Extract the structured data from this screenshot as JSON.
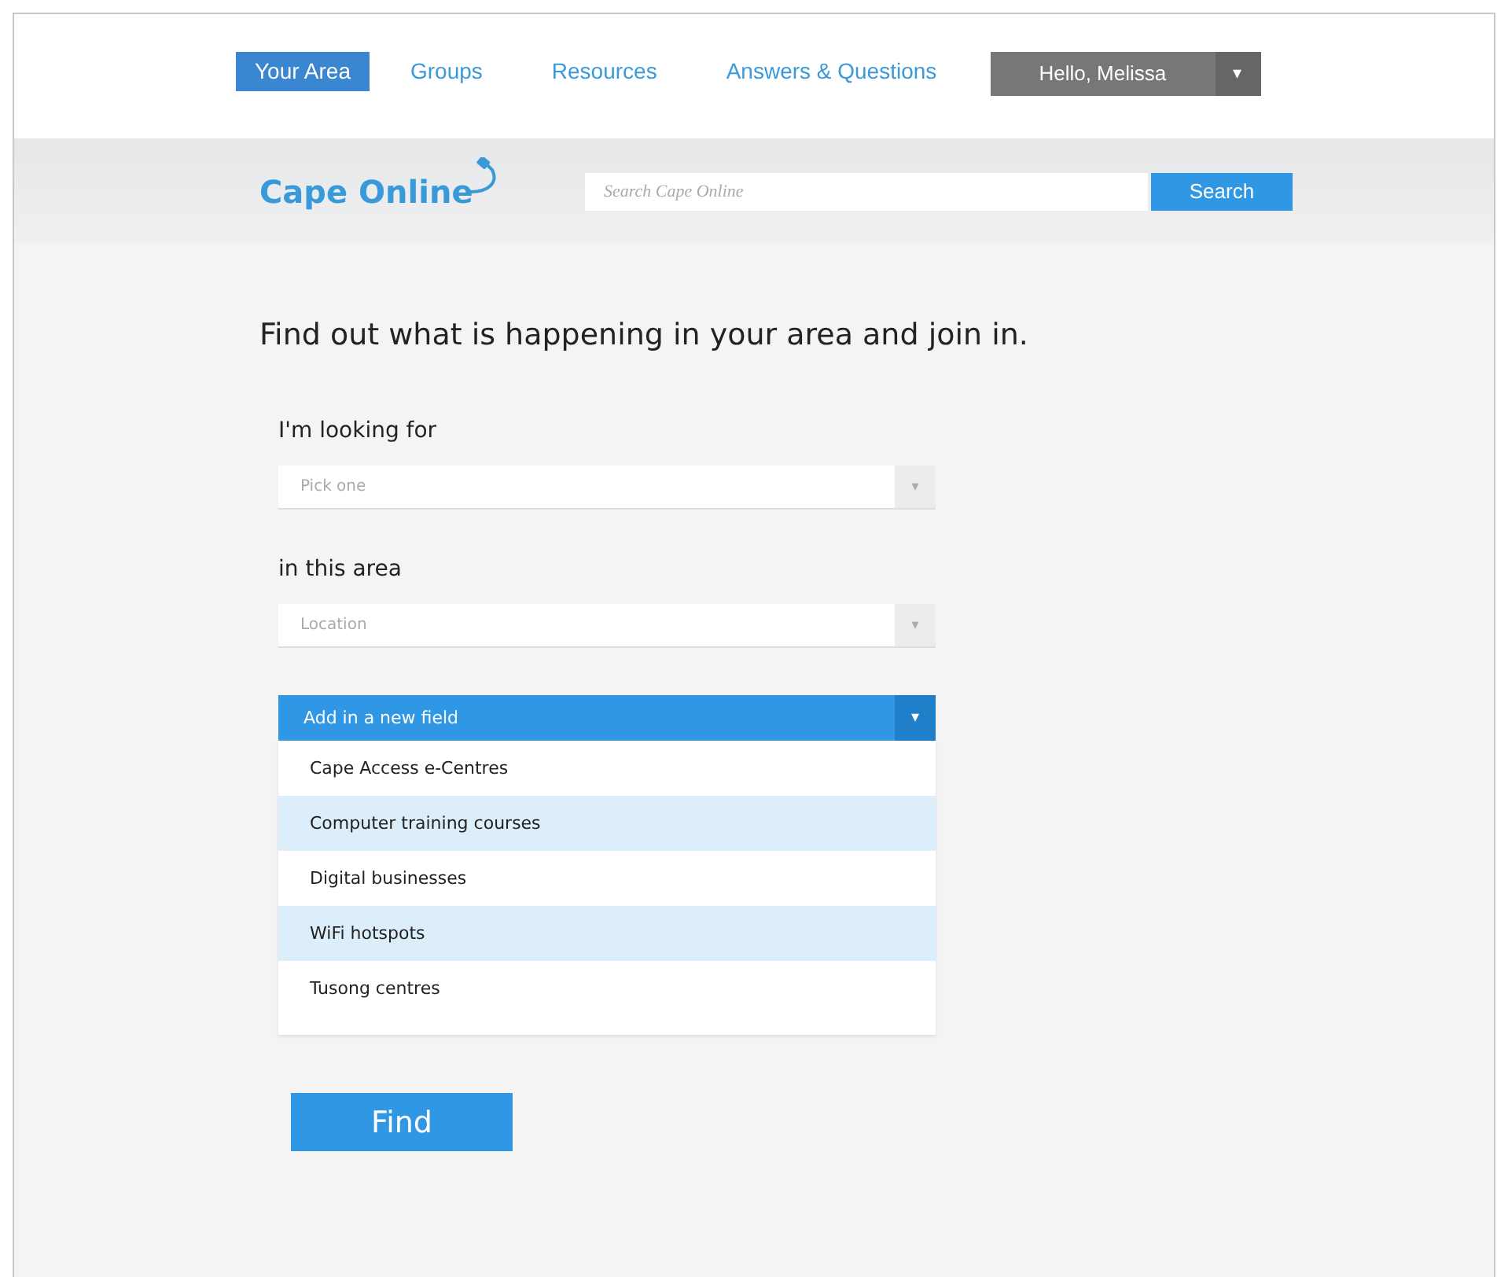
{
  "nav": {
    "tabs": [
      {
        "label": "Your Area",
        "selected": true
      },
      {
        "label": "Groups",
        "selected": false
      },
      {
        "label": "Resources",
        "selected": false
      },
      {
        "label": "Answers & Questions",
        "selected": false
      }
    ],
    "user_menu": {
      "label": "Hello, Melissa",
      "caret": "▾"
    }
  },
  "header": {
    "logo": "Cape Online",
    "search": {
      "placeholder": "Search Cape Online",
      "button": "Search"
    }
  },
  "heading": "Find out what is happening in your area and join in.",
  "fields": [
    {
      "label": "I'm looking for",
      "placeholder": "Pick one",
      "caret": "▾"
    },
    {
      "label": "in this area",
      "placeholder": "Location",
      "caret": "▾"
    }
  ],
  "dropdown": {
    "label": "Add in a new field",
    "caret": "▾",
    "options": [
      {
        "label": "Cape Access e-Centres",
        "selected": false
      },
      {
        "label": "Computer training courses",
        "selected": true
      },
      {
        "label": "Digital businesses",
        "selected": false
      },
      {
        "label": "WiFi hotspots",
        "selected": true
      },
      {
        "label": "Tusong centres",
        "selected": false
      }
    ]
  },
  "find_button": "Find"
}
